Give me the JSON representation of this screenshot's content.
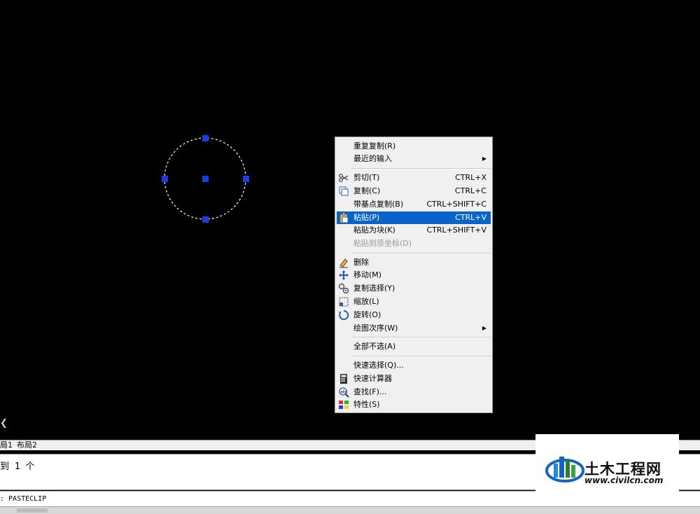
{
  "canvas": {},
  "context_menu": {
    "items": [
      {
        "label": "重复复制(R)",
        "shortcut": "",
        "icon": "",
        "submenu": false,
        "disabled": false,
        "highlighted": false
      },
      {
        "label": "最近的输入",
        "shortcut": "",
        "icon": "",
        "submenu": true,
        "disabled": false,
        "highlighted": false
      },
      {
        "label": "剪切(T)",
        "shortcut": "CTRL+X",
        "icon": "scissors-icon",
        "submenu": false,
        "disabled": false,
        "highlighted": false
      },
      {
        "label": "复制(C)",
        "shortcut": "CTRL+C",
        "icon": "copy-icon",
        "submenu": false,
        "disabled": false,
        "highlighted": false
      },
      {
        "label": "带基点复制(B)",
        "shortcut": "CTRL+SHIFT+C",
        "icon": "",
        "submenu": false,
        "disabled": false,
        "highlighted": false
      },
      {
        "label": "粘贴(P)",
        "shortcut": "CTRL+V",
        "icon": "paste-icon",
        "submenu": false,
        "disabled": false,
        "highlighted": true
      },
      {
        "label": "粘贴为块(K)",
        "shortcut": "CTRL+SHIFT+V",
        "icon": "",
        "submenu": false,
        "disabled": false,
        "highlighted": false
      },
      {
        "label": "粘贴到原坐标(D)",
        "shortcut": "",
        "icon": "",
        "submenu": false,
        "disabled": true,
        "highlighted": false
      },
      {
        "label": "删除",
        "shortcut": "",
        "icon": "eraser-icon",
        "submenu": false,
        "disabled": false,
        "highlighted": false
      },
      {
        "label": "移动(M)",
        "shortcut": "",
        "icon": "move-icon",
        "submenu": false,
        "disabled": false,
        "highlighted": false
      },
      {
        "label": "复制选择(Y)",
        "shortcut": "",
        "icon": "copy-selection-icon",
        "submenu": false,
        "disabled": false,
        "highlighted": false
      },
      {
        "label": "缩放(L)",
        "shortcut": "",
        "icon": "scale-icon",
        "submenu": false,
        "disabled": false,
        "highlighted": false
      },
      {
        "label": "旋转(O)",
        "shortcut": "",
        "icon": "rotate-icon",
        "submenu": false,
        "disabled": false,
        "highlighted": false
      },
      {
        "label": "绘图次序(W)",
        "shortcut": "",
        "icon": "",
        "submenu": true,
        "disabled": false,
        "highlighted": false
      },
      {
        "label": "全部不选(A)",
        "shortcut": "",
        "icon": "",
        "submenu": false,
        "disabled": false,
        "highlighted": false
      },
      {
        "label": "快速选择(Q)...",
        "shortcut": "",
        "icon": "",
        "submenu": false,
        "disabled": false,
        "highlighted": false
      },
      {
        "label": "快速计算器",
        "shortcut": "",
        "icon": "calculator-icon",
        "submenu": false,
        "disabled": false,
        "highlighted": false
      },
      {
        "label": "查找(F)...",
        "shortcut": "",
        "icon": "find-icon",
        "submenu": false,
        "disabled": false,
        "highlighted": false
      },
      {
        "label": "特性(S)",
        "shortcut": "",
        "icon": "properties-icon",
        "submenu": false,
        "disabled": false,
        "highlighted": false
      }
    ]
  },
  "layout_tabs": [
    "局1",
    "布局2"
  ],
  "command": {
    "history_line": "到 1 个",
    "current_line": ":  PASTECLIP"
  },
  "watermark": {
    "name": "土木工程网",
    "url": "www.civilcn.com"
  },
  "colors": {
    "canvas_bg": "#000000",
    "grip": "#1a3fe0",
    "menu_highlight": "#0a63c9",
    "menu_bg": "#f0f0f0"
  }
}
